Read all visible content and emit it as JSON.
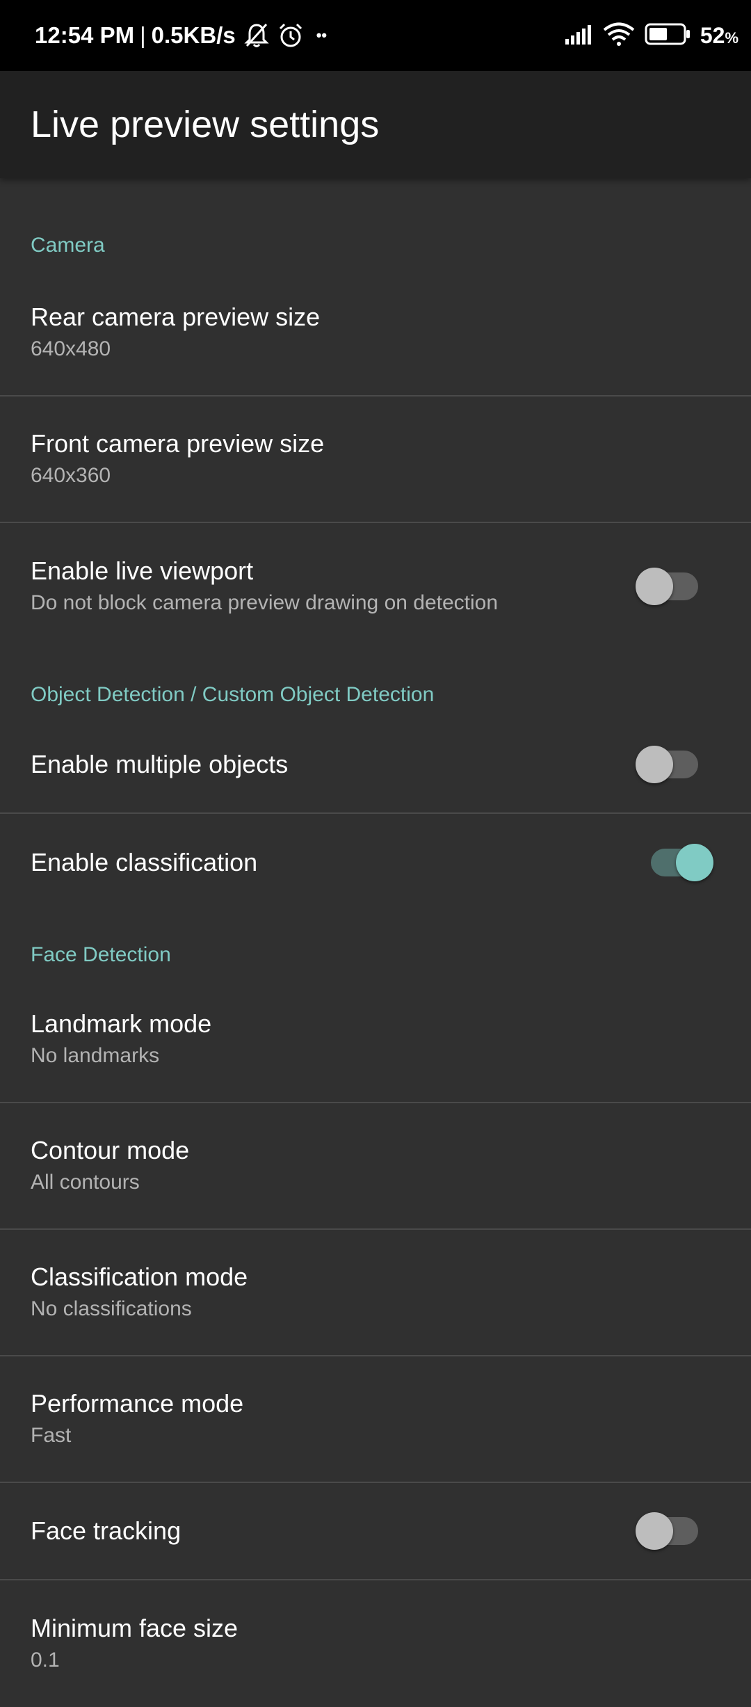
{
  "status_bar": {
    "time": "12:54 PM",
    "separator": "|",
    "net_speed": "0.5KB/s",
    "more": "••",
    "battery_value": "52",
    "battery_unit": "%"
  },
  "app_bar": {
    "title": "Live preview settings"
  },
  "categories": {
    "camera": "Camera",
    "object_detection": "Object Detection / Custom Object Detection",
    "face_detection": "Face Detection"
  },
  "prefs": {
    "rear_preview": {
      "title": "Rear camera preview size",
      "summary": "640x480"
    },
    "front_preview": {
      "title": "Front camera preview size",
      "summary": "640x360"
    },
    "live_viewport": {
      "title": "Enable live viewport",
      "summary": "Do not block camera preview drawing on detection",
      "enabled": false
    },
    "multiple_objects": {
      "title": "Enable multiple objects",
      "enabled": false
    },
    "classification": {
      "title": "Enable classification",
      "enabled": true
    },
    "landmark_mode": {
      "title": "Landmark mode",
      "summary": "No landmarks"
    },
    "contour_mode": {
      "title": "Contour mode",
      "summary": "All contours"
    },
    "classification_mode": {
      "title": "Classification mode",
      "summary": "No classifications"
    },
    "performance_mode": {
      "title": "Performance mode",
      "summary": "Fast"
    },
    "face_tracking": {
      "title": "Face tracking",
      "enabled": false
    },
    "min_face_size": {
      "title": "Minimum face size",
      "summary": "0.1"
    }
  },
  "colors": {
    "accent": "#80cbc4",
    "background": "#303030",
    "app_bar": "#212121",
    "status_bar": "#000000"
  },
  "icons": [
    "bell-off-icon",
    "alarm-icon",
    "signal-icon",
    "wifi-icon",
    "battery-icon"
  ]
}
